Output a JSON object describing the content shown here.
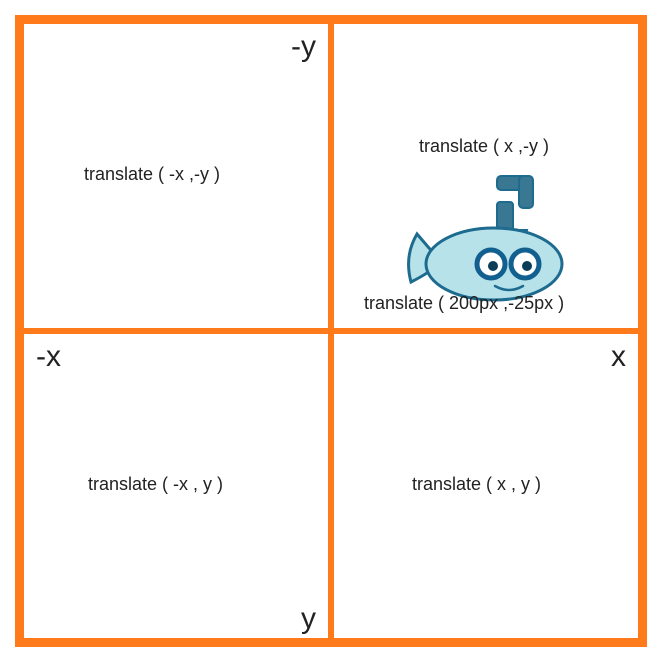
{
  "axes": {
    "neg_y": "-y",
    "neg_x": "-x",
    "pos_x": "x",
    "pos_y": "y"
  },
  "quadrants": {
    "q1": {
      "fn": "translate ( x ,-y )",
      "example": "translate ( 200px ,-25px )"
    },
    "q2": {
      "fn": "translate ( -x ,-y )"
    },
    "q3": {
      "fn": "translate ( -x , y )"
    },
    "q4": {
      "fn": "translate ( x , y )"
    }
  },
  "icon": {
    "name": "submarine-icon",
    "body_fill": "#b7e2ea",
    "body_stroke": "#1d6b8f",
    "accent_fill": "#3a7792",
    "eye_ring": "#12608f",
    "eye_white": "#ffffff",
    "eye_pupil": "#0b3d57"
  }
}
